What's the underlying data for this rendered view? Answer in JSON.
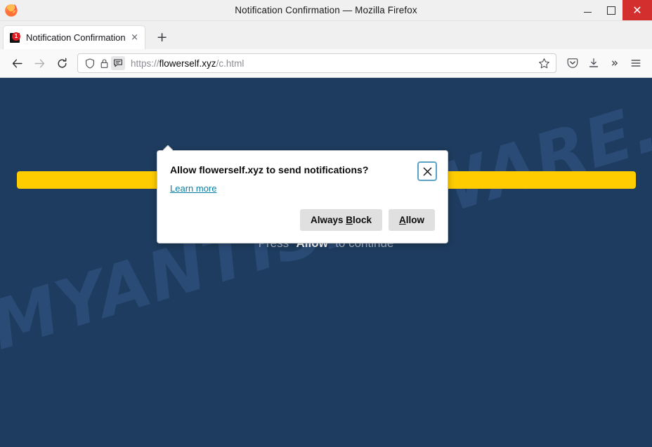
{
  "window": {
    "title": "Notification Confirmation — Mozilla Firefox",
    "minimize_label": "Minimize",
    "maximize_label": "Maximize",
    "close_label": "Close"
  },
  "tabs": [
    {
      "title": "Notification Confirmation",
      "badge": "1",
      "close_glyph": "×"
    }
  ],
  "newtab": {
    "glyph": "+"
  },
  "toolbar": {
    "back_label": "Back",
    "forward_label": "Forward",
    "reload_label": "Reload",
    "pocket_label": "Save to Pocket",
    "downloads_label": "Downloads",
    "overflow_glyph": "»",
    "menu_label": "Open application menu",
    "bookmark_label": "Bookmark this page"
  },
  "urlbar": {
    "shield_label": "Tracking protection",
    "lock_label": "Connection secure",
    "permission_label": "Notification permission requested",
    "scheme": "https://",
    "host": "flowerself.xyz",
    "path": "/c.html"
  },
  "page": {
    "background_color": "#1e3c5f",
    "accent_bar_color": "#ffcc00",
    "watermark": "MYANTISPYWARE.COM",
    "instruction_prefix": "Press “",
    "instruction_highlight": "Allow",
    "instruction_suffix": "” to continue"
  },
  "popup": {
    "title": "Allow flowerself.xyz to send notifications?",
    "learn_more": "Learn more",
    "close_glyph": "✕",
    "buttons": {
      "block_prefix": "Always ",
      "block_key": "B",
      "block_suffix": "lock",
      "allow_key": "A",
      "allow_suffix": "llow"
    }
  }
}
